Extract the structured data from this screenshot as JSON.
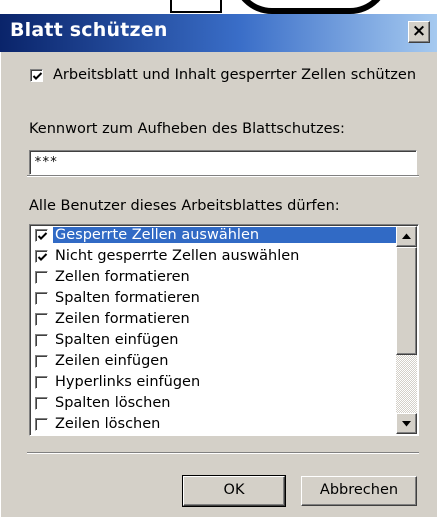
{
  "window": {
    "title": "Blatt schützen",
    "close_label": "×"
  },
  "protect_checkbox": {
    "checked": true,
    "label": "Arbeitsblatt und Inhalt gesperrter Zellen schützen"
  },
  "password": {
    "label": "Kennwort zum Aufheben des Blattschutzes:",
    "value": "***"
  },
  "permissions": {
    "label": "Alle Benutzer dieses Arbeitsblattes dürfen:",
    "items": [
      {
        "label": "Gesperrte Zellen auswählen",
        "checked": true,
        "selected": true
      },
      {
        "label": "Nicht gesperrte Zellen auswählen",
        "checked": true,
        "selected": false
      },
      {
        "label": "Zellen formatieren",
        "checked": false,
        "selected": false
      },
      {
        "label": "Spalten formatieren",
        "checked": false,
        "selected": false
      },
      {
        "label": "Zeilen formatieren",
        "checked": false,
        "selected": false
      },
      {
        "label": "Spalten einfügen",
        "checked": false,
        "selected": false
      },
      {
        "label": "Zeilen einfügen",
        "checked": false,
        "selected": false
      },
      {
        "label": "Hyperlinks einfügen",
        "checked": false,
        "selected": false
      },
      {
        "label": "Spalten löschen",
        "checked": false,
        "selected": false
      },
      {
        "label": "Zeilen löschen",
        "checked": false,
        "selected": false
      }
    ]
  },
  "buttons": {
    "ok": "OK",
    "cancel": "Abbrechen"
  },
  "colors": {
    "selection": "#316ac5",
    "dialog_face": "#d4d0c8",
    "title_start": "#0a246a",
    "title_end": "#a6caf0"
  }
}
